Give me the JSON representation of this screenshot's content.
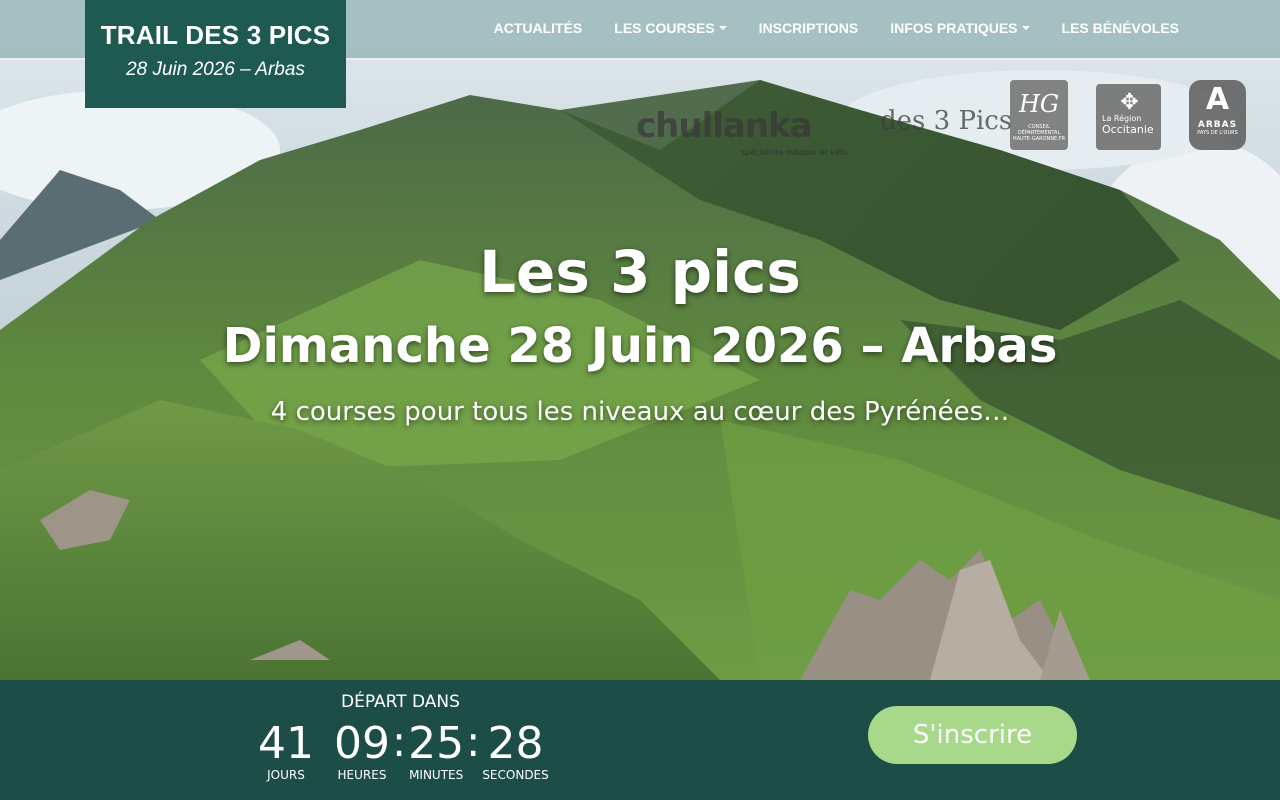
{
  "brand": {
    "title": "TRAIL DES 3 PICS",
    "subtitle": "28 Juin 2026 – Arbas"
  },
  "nav": {
    "items": [
      {
        "label": "ACTUALITÉS",
        "dropdown": false
      },
      {
        "label": "LES COURSES",
        "dropdown": true
      },
      {
        "label": "INSCRIPTIONS",
        "dropdown": false
      },
      {
        "label": "INFOS PRATIQUES",
        "dropdown": true
      },
      {
        "label": "LES BÉNÉVOLES",
        "dropdown": false
      }
    ]
  },
  "sponsors": {
    "chullanka": {
      "name": "chullanka",
      "tagline": "spécialiste outdoor et vélo"
    },
    "trail3pics": {
      "name": "des 3 Pics"
    },
    "hg": {
      "name": "HG",
      "caption": "CONSEIL DÉPARTEMENTAL HAUTE-GARONNE.FR"
    },
    "occitanie": {
      "line1": "La Région",
      "line2": "Occitanie"
    },
    "arbas": {
      "name": "ARBAS",
      "caption": "PAYS DE L'OURS"
    }
  },
  "hero": {
    "title": "Les 3 pics",
    "date": "Dimanche 28 Juin 2026 – Arbas",
    "tagline": "4 courses pour tous les niveaux au cœur des Pyrénées…"
  },
  "countdown": {
    "label": "DÉPART DANS",
    "days": {
      "value": "41",
      "label": "JOURS"
    },
    "hours": {
      "value": "09",
      "label": "HEURES"
    },
    "minutes": {
      "value": "25",
      "label": "MINUTES"
    },
    "seconds": {
      "value": "28",
      "label": "SECONDES"
    }
  },
  "cta": {
    "label": "S'inscrire"
  },
  "colors": {
    "brand": "#1e5a52",
    "bar": "#1c4d46",
    "cta": "#a8d98a"
  }
}
